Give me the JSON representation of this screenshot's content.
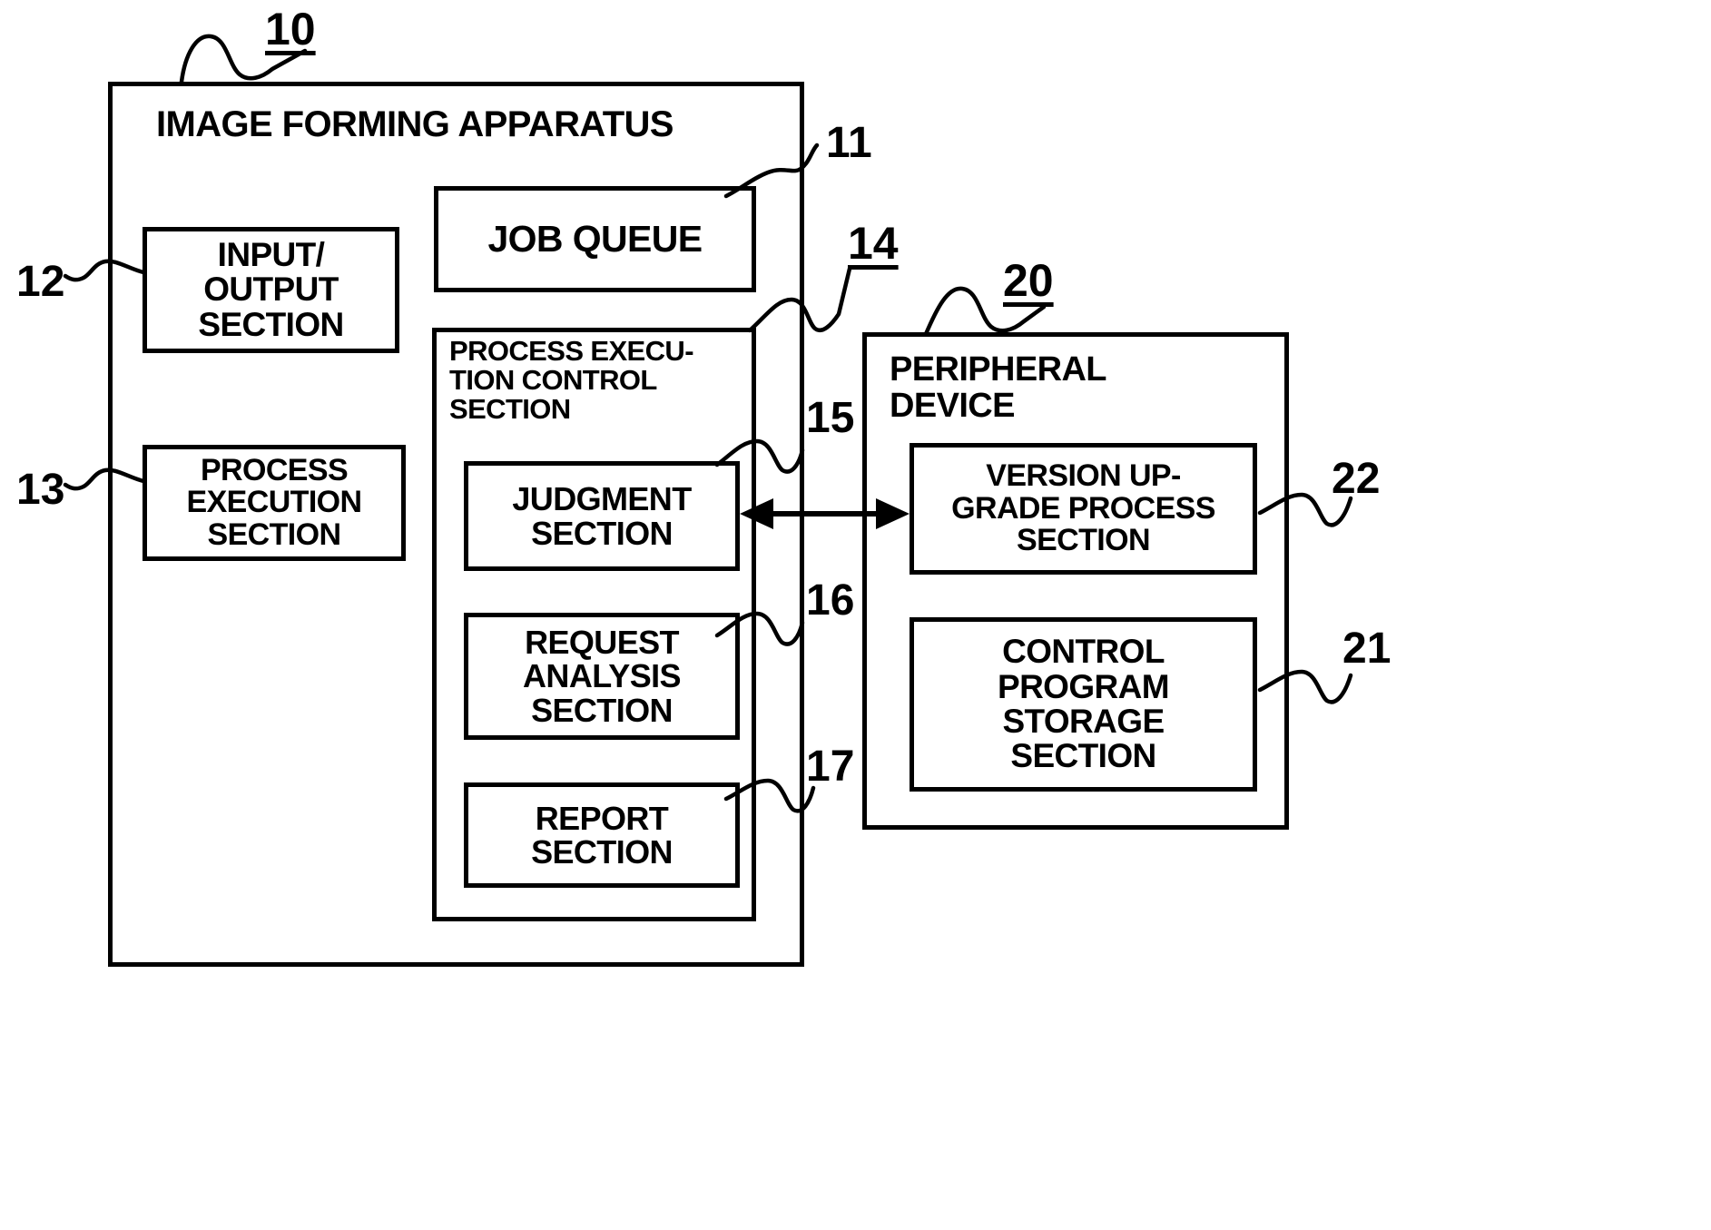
{
  "figure": {
    "type": "patent-block-diagram",
    "background": "#ffffff",
    "stroke": "#000000"
  },
  "outer_blocks": [
    {
      "id": "image-forming-apparatus",
      "ref": "10",
      "label": "IMAGE FORMING APPARATUS"
    },
    {
      "id": "peripheral-device",
      "ref": "20",
      "label": "PERIPHERAL\nDEVICE"
    }
  ],
  "blocks": {
    "input_output": {
      "ref": "12",
      "label": "INPUT/\nOUTPUT\nSECTION"
    },
    "process_execution": {
      "ref": "13",
      "label": "PROCESS\nEXECUTION\nSECTION"
    },
    "job_queue": {
      "ref": "11",
      "label": "JOB QUEUE"
    },
    "process_execution_control": {
      "ref": "14",
      "label": "PROCESS EXECU-\nTION CONTROL\nSECTION"
    },
    "judgment": {
      "ref": "15",
      "label": "JUDGMENT\nSECTION"
    },
    "request_analysis": {
      "ref": "16",
      "label": "REQUEST\nANALYSIS\nSECTION"
    },
    "report": {
      "ref": "17",
      "label": "REPORT\nSECTION"
    },
    "version_upgrade": {
      "ref": "22",
      "label": "VERSION UP-\nGRADE PROCESS\nSECTION"
    },
    "control_program_storage": {
      "ref": "21",
      "label": "CONTROL\nPROGRAM\nSTORAGE\nSECTION"
    }
  },
  "reference_numerals": [
    {
      "id": "ref-10",
      "text": "10",
      "underlined": true
    },
    {
      "id": "ref-11",
      "text": "11",
      "underlined": false
    },
    {
      "id": "ref-12",
      "text": "12",
      "underlined": false
    },
    {
      "id": "ref-13",
      "text": "13",
      "underlined": false
    },
    {
      "id": "ref-14",
      "text": "14",
      "underlined": true
    },
    {
      "id": "ref-15",
      "text": "15",
      "underlined": false
    },
    {
      "id": "ref-16",
      "text": "16",
      "underlined": false
    },
    {
      "id": "ref-17",
      "text": "17",
      "underlined": false
    },
    {
      "id": "ref-20",
      "text": "20",
      "underlined": true
    },
    {
      "id": "ref-21",
      "text": "21",
      "underlined": false
    },
    {
      "id": "ref-22",
      "text": "22",
      "underlined": false
    }
  ],
  "connectors": [
    {
      "id": "judgment-to-version-upgrade",
      "kind": "double-arrow",
      "from": "judgment",
      "to": "version_upgrade"
    }
  ]
}
